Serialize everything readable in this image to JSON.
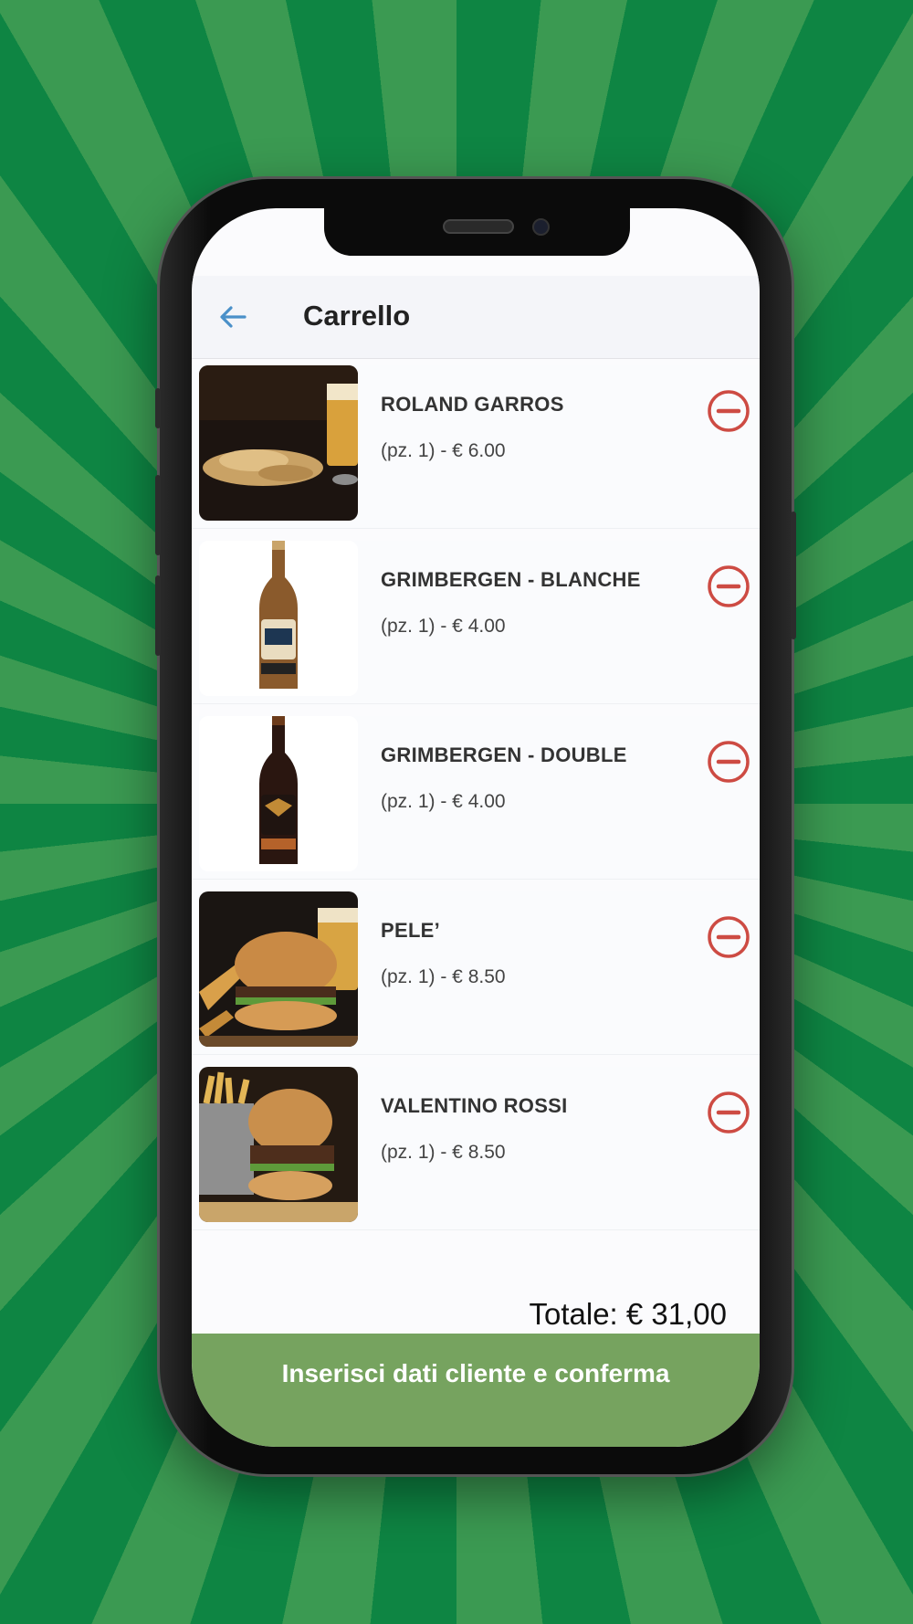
{
  "header": {
    "title": "Carrello"
  },
  "cart": {
    "items": [
      {
        "name": "ROLAND GARROS",
        "detail": "(pz. 1) - € 6.00",
        "image": "chips-and-beer"
      },
      {
        "name": "GRIMBERGEN - BLANCHE",
        "detail": "(pz. 1) - € 4.00",
        "image": "beer-bottle-blanche"
      },
      {
        "name": "GRIMBERGEN - DOUBLE",
        "detail": "(pz. 1) - € 4.00",
        "image": "beer-bottle-double"
      },
      {
        "name": "PELE’",
        "detail": "(pz. 1) - € 8.50",
        "image": "burger-with-fries"
      },
      {
        "name": "VALENTINO ROSSI",
        "detail": "(pz. 1) - € 8.50",
        "image": "burger-with-fries-basket"
      }
    ],
    "total": "Totale: € 31,00"
  },
  "footer": {
    "confirm_label": "Inserisci dati cliente e conferma"
  },
  "colors": {
    "background": "#0f8a45",
    "accent_blue": "#4a90c9",
    "remove_red": "#cd4b43",
    "confirm_green": "#76a35f"
  },
  "icons": {
    "back": "arrow-left-icon",
    "remove": "minus-circle-icon"
  }
}
